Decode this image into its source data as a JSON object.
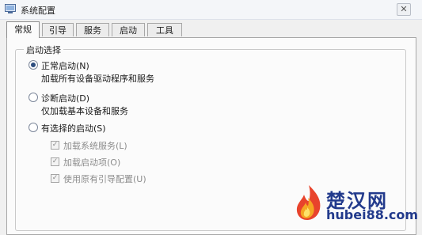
{
  "window": {
    "title": "系统配置"
  },
  "tabs": [
    {
      "label": "常规"
    },
    {
      "label": "引导"
    },
    {
      "label": "服务"
    },
    {
      "label": "启动"
    },
    {
      "label": "工具"
    }
  ],
  "startup_group": {
    "legend": "启动选择",
    "options": [
      {
        "label": "正常启动(N)",
        "description": "加载所有设备驱动程序和服务",
        "selected": true
      },
      {
        "label": "诊断启动(D)",
        "description": "仅加载基本设备和服务",
        "selected": false
      },
      {
        "label": "有选择的启动(S)",
        "selected": false
      }
    ],
    "selective_items": [
      {
        "label": "加载系统服务(L)",
        "checked": true
      },
      {
        "label": "加载启动项(O)",
        "checked": true
      },
      {
        "label": "使用原有引导配置(U)",
        "checked": true
      }
    ]
  },
  "watermark": {
    "title": "楚汉网",
    "subtitle": "hubei88.com"
  }
}
